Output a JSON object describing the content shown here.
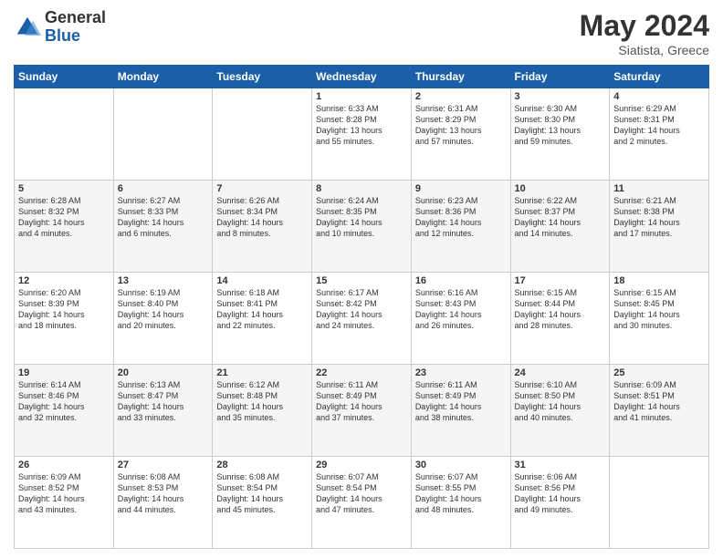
{
  "header": {
    "logo_general": "General",
    "logo_blue": "Blue",
    "month_year": "May 2024",
    "location": "Siatista, Greece"
  },
  "days_of_week": [
    "Sunday",
    "Monday",
    "Tuesday",
    "Wednesday",
    "Thursday",
    "Friday",
    "Saturday"
  ],
  "weeks": [
    [
      {
        "day": "",
        "content": ""
      },
      {
        "day": "",
        "content": ""
      },
      {
        "day": "",
        "content": ""
      },
      {
        "day": "1",
        "content": "Sunrise: 6:33 AM\nSunset: 8:28 PM\nDaylight: 13 hours\nand 55 minutes."
      },
      {
        "day": "2",
        "content": "Sunrise: 6:31 AM\nSunset: 8:29 PM\nDaylight: 13 hours\nand 57 minutes."
      },
      {
        "day": "3",
        "content": "Sunrise: 6:30 AM\nSunset: 8:30 PM\nDaylight: 13 hours\nand 59 minutes."
      },
      {
        "day": "4",
        "content": "Sunrise: 6:29 AM\nSunset: 8:31 PM\nDaylight: 14 hours\nand 2 minutes."
      }
    ],
    [
      {
        "day": "5",
        "content": "Sunrise: 6:28 AM\nSunset: 8:32 PM\nDaylight: 14 hours\nand 4 minutes."
      },
      {
        "day": "6",
        "content": "Sunrise: 6:27 AM\nSunset: 8:33 PM\nDaylight: 14 hours\nand 6 minutes."
      },
      {
        "day": "7",
        "content": "Sunrise: 6:26 AM\nSunset: 8:34 PM\nDaylight: 14 hours\nand 8 minutes."
      },
      {
        "day": "8",
        "content": "Sunrise: 6:24 AM\nSunset: 8:35 PM\nDaylight: 14 hours\nand 10 minutes."
      },
      {
        "day": "9",
        "content": "Sunrise: 6:23 AM\nSunset: 8:36 PM\nDaylight: 14 hours\nand 12 minutes."
      },
      {
        "day": "10",
        "content": "Sunrise: 6:22 AM\nSunset: 8:37 PM\nDaylight: 14 hours\nand 14 minutes."
      },
      {
        "day": "11",
        "content": "Sunrise: 6:21 AM\nSunset: 8:38 PM\nDaylight: 14 hours\nand 17 minutes."
      }
    ],
    [
      {
        "day": "12",
        "content": "Sunrise: 6:20 AM\nSunset: 8:39 PM\nDaylight: 14 hours\nand 18 minutes."
      },
      {
        "day": "13",
        "content": "Sunrise: 6:19 AM\nSunset: 8:40 PM\nDaylight: 14 hours\nand 20 minutes."
      },
      {
        "day": "14",
        "content": "Sunrise: 6:18 AM\nSunset: 8:41 PM\nDaylight: 14 hours\nand 22 minutes."
      },
      {
        "day": "15",
        "content": "Sunrise: 6:17 AM\nSunset: 8:42 PM\nDaylight: 14 hours\nand 24 minutes."
      },
      {
        "day": "16",
        "content": "Sunrise: 6:16 AM\nSunset: 8:43 PM\nDaylight: 14 hours\nand 26 minutes."
      },
      {
        "day": "17",
        "content": "Sunrise: 6:15 AM\nSunset: 8:44 PM\nDaylight: 14 hours\nand 28 minutes."
      },
      {
        "day": "18",
        "content": "Sunrise: 6:15 AM\nSunset: 8:45 PM\nDaylight: 14 hours\nand 30 minutes."
      }
    ],
    [
      {
        "day": "19",
        "content": "Sunrise: 6:14 AM\nSunset: 8:46 PM\nDaylight: 14 hours\nand 32 minutes."
      },
      {
        "day": "20",
        "content": "Sunrise: 6:13 AM\nSunset: 8:47 PM\nDaylight: 14 hours\nand 33 minutes."
      },
      {
        "day": "21",
        "content": "Sunrise: 6:12 AM\nSunset: 8:48 PM\nDaylight: 14 hours\nand 35 minutes."
      },
      {
        "day": "22",
        "content": "Sunrise: 6:11 AM\nSunset: 8:49 PM\nDaylight: 14 hours\nand 37 minutes."
      },
      {
        "day": "23",
        "content": "Sunrise: 6:11 AM\nSunset: 8:49 PM\nDaylight: 14 hours\nand 38 minutes."
      },
      {
        "day": "24",
        "content": "Sunrise: 6:10 AM\nSunset: 8:50 PM\nDaylight: 14 hours\nand 40 minutes."
      },
      {
        "day": "25",
        "content": "Sunrise: 6:09 AM\nSunset: 8:51 PM\nDaylight: 14 hours\nand 41 minutes."
      }
    ],
    [
      {
        "day": "26",
        "content": "Sunrise: 6:09 AM\nSunset: 8:52 PM\nDaylight: 14 hours\nand 43 minutes."
      },
      {
        "day": "27",
        "content": "Sunrise: 6:08 AM\nSunset: 8:53 PM\nDaylight: 14 hours\nand 44 minutes."
      },
      {
        "day": "28",
        "content": "Sunrise: 6:08 AM\nSunset: 8:54 PM\nDaylight: 14 hours\nand 45 minutes."
      },
      {
        "day": "29",
        "content": "Sunrise: 6:07 AM\nSunset: 8:54 PM\nDaylight: 14 hours\nand 47 minutes."
      },
      {
        "day": "30",
        "content": "Sunrise: 6:07 AM\nSunset: 8:55 PM\nDaylight: 14 hours\nand 48 minutes."
      },
      {
        "day": "31",
        "content": "Sunrise: 6:06 AM\nSunset: 8:56 PM\nDaylight: 14 hours\nand 49 minutes."
      },
      {
        "day": "",
        "content": ""
      }
    ]
  ]
}
